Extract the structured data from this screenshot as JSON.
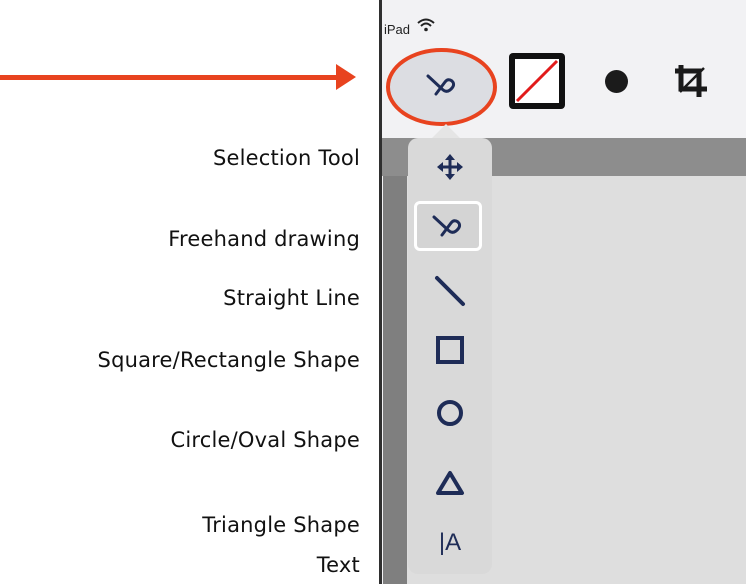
{
  "annotations": {
    "selection_tool": "Selection Tool",
    "freehand": "Freehand drawing",
    "straight_line": "Straight Line",
    "square": "Square/Rectangle Shape",
    "circle": "Circle/Oval Shape",
    "triangle": "Triangle Shape",
    "text": "Text"
  },
  "status_bar": {
    "device": "iPad"
  },
  "toolbar": {
    "items": [
      {
        "name": "freehand-tool",
        "icon": "squiggle-icon"
      },
      {
        "name": "color-swatch",
        "icon": "no-fill-slash-icon"
      },
      {
        "name": "brush-size",
        "icon": "dot-icon"
      },
      {
        "name": "crop",
        "icon": "crop-icon"
      }
    ]
  },
  "tool_menu": {
    "items": [
      {
        "name": "selection",
        "icon": "move-arrows-icon"
      },
      {
        "name": "freehand",
        "icon": "squiggle-icon",
        "active": true
      },
      {
        "name": "line",
        "icon": "diagonal-line-icon"
      },
      {
        "name": "rectangle",
        "icon": "square-icon"
      },
      {
        "name": "oval",
        "icon": "circle-icon"
      },
      {
        "name": "triangle",
        "icon": "triangle-icon"
      },
      {
        "name": "text",
        "icon": "text-cursor-icon",
        "glyph": "|A"
      }
    ]
  },
  "colors": {
    "accent": "#e8431f",
    "icon_navy": "#1e2c57",
    "menu_bg": "#d9d9d9",
    "canvas": "#dedede"
  }
}
